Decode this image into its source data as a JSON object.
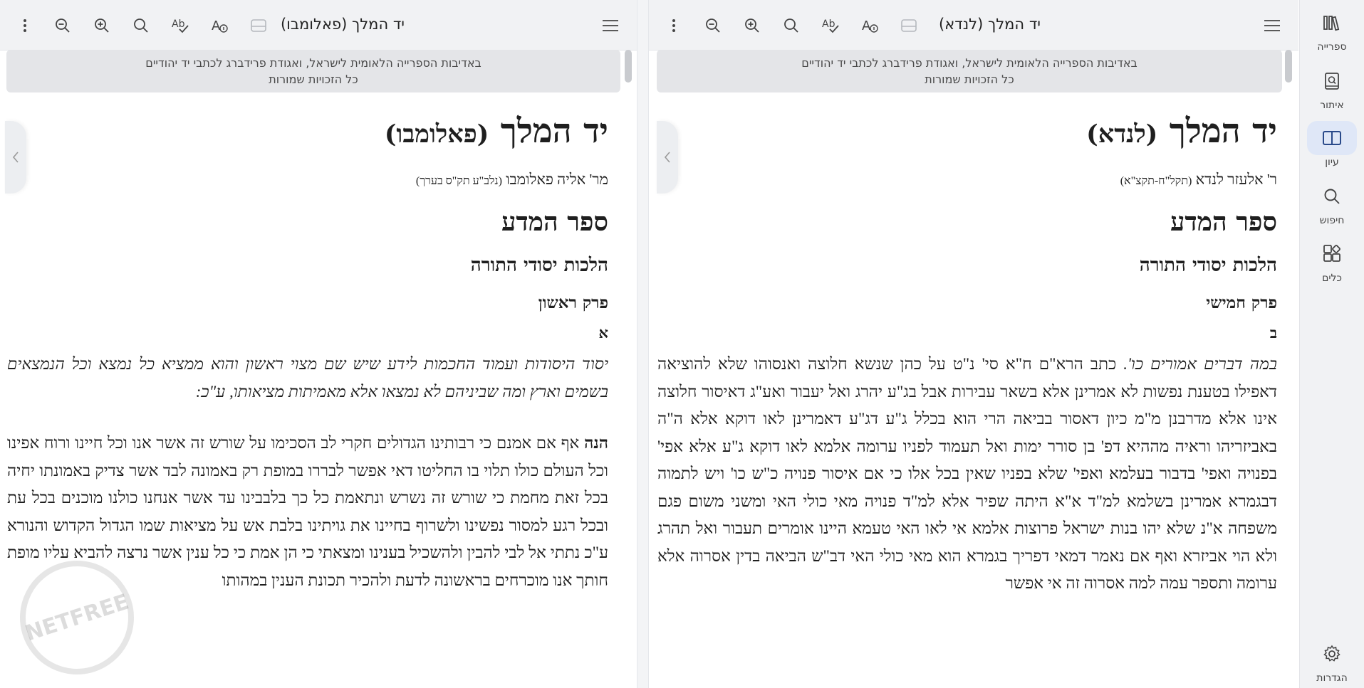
{
  "rail": {
    "items": [
      {
        "label": "ספרייה",
        "icon": "library-icon"
      },
      {
        "label": "איתור",
        "icon": "find-book-icon"
      },
      {
        "label": "עיון",
        "icon": "book-open-icon"
      },
      {
        "label": "חיפוש",
        "icon": "search-icon"
      },
      {
        "label": "כלים",
        "icon": "tools-icon"
      }
    ],
    "settings_label": "הגדרות",
    "active": "עיון"
  },
  "left_pane": {
    "tab_title": "יד המלך (פאלומבו)",
    "banner_line1": "באדיבות הספרייה הלאומית לישראל, ואגודת פרידברג לכתבי יד יהודיים",
    "banner_line2": "כל הזכויות שמורות",
    "title_main": "יד המלך",
    "title_paren": "(פאלומבו)",
    "author": "מר' אליה פאלומבו",
    "author_dates": "(נלב\"ע תק\"ס בערך)",
    "book": "ספר המדע",
    "section": "הלכות יסודי התורה",
    "chapter": "פרק ראשון",
    "halacha": "א",
    "quote": "יסוד היסודות ועמוד החכמות לידע שיש שם מצוי ראשון והוא ממציא כל נמצא וכל הנמצאים בשמים וארץ ומה שביניהם לא נמצאו אלא מאמיתות מציאותו, ע\"כ:",
    "body_bold": "הנה",
    "body": "אף אם אמנם כי רבותינו הגדולים חקרי לב הסכימו על שורש זה אשר אנו וכל חיינו ורוח אפינו וכל העולם כולו תלוי בו החליטו דאי אפשר לבררו במופת רק באמונה לבד אשר צדיק באמונתו יחיה בכל זאת מחמת כי שורש זה נשרש ונתאמת כל כך בלבבינו עד אשר אנחנו כולנו מוכנים בכל עת ובכל רגע למסור נפשינו ולשרוף בחיינו את גויתינו בלבת אש על מציאות שמו הגדול הקדוש והנורא ע\"כ נתתי אל לבי להבין ולהשכיל בענינו ומצאתי כי הן אמת כי כל ענין אשר נרצה להביא עליו מופת חותך אנו מוכרחים בראשונה לדעת ולהכיר תכונת הענין במהותו"
  },
  "right_pane": {
    "tab_title": "יד המלך (לנדא)",
    "banner_line1": "באדיבות הספרייה הלאומית לישראל, ואגודת פרידברג לכתבי יד יהודיים",
    "banner_line2": "כל הזכויות שמורות",
    "title_main": "יד המלך",
    "title_paren": "(לנדא)",
    "author": "ר' אלעזר לנדא",
    "author_dates": "(תקל\"ח-תקצ\"א)",
    "book": "ספר המדע",
    "section": "הלכות יסודי התורה",
    "chapter": "פרק חמישי",
    "halacha": "ב",
    "quote_italic": "במה דברים אמורים כו'.",
    "body": "כתב הרא\"ם ח\"א סי' נ\"ט על כהן שנשא חלוצה ואנסוהו שלא להוציאה דאפילו בטענת נפשות לא אמרינן אלא בשאר עבירות אבל בג\"ע יהרג ואל יעבור ואע\"ג דאיסור חלוצה אינו אלא מדרבנן מ\"מ כיון דאסור בביאה הרי הוא בכלל ג\"ע דג\"ע דאמרינן לאו דוקא אלא ה\"ה באביזריהו וראיה מההיא דפ' בן סורר ימות ואל תעמוד לפניו ערומה אלמא לאו דוקא ג\"ע אלא אפי' בפנויה ואפי' בדבור בעלמא ואפי' שלא בפניו שאין בכל אלו כי אם איסור פנויה כ\"ש כו' ויש לתמוה דבגמרא אמרינן בשלמא למ\"ד א\"א היתה שפיר אלא למ\"ד פנויה מאי כולי האי ומשני משום פגם משפחה א\"נ שלא יהו בנות ישראל פרוצות אלמא אי לאו האי טעמא היינו אומרים תעבור ואל תהרג ולא הוי אביזרא ואף אם נאמר דמאי דפריך בגמרא הוא מאי כולי האי דב\"ש הביאה בדין אסרוה אלא ערומה ותספר עמה למה אסרוה זה אי אפשר"
  },
  "watermark_text": "NETFREE"
}
